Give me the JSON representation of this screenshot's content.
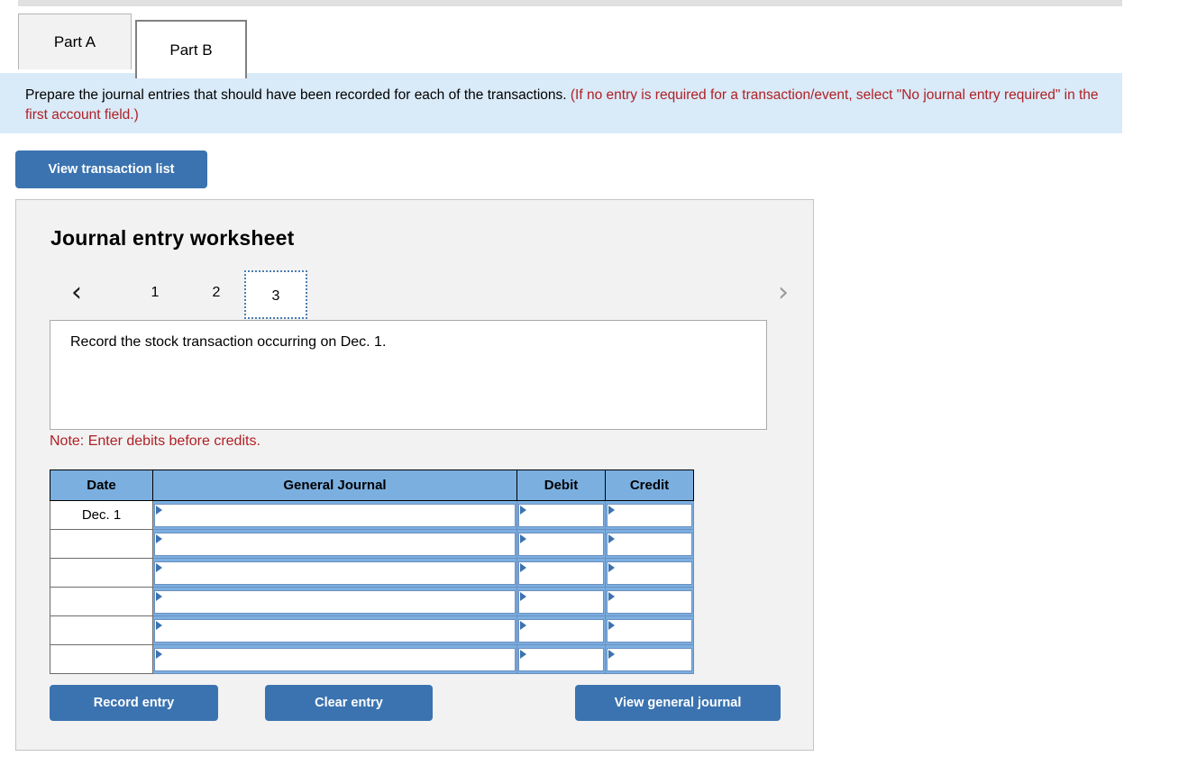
{
  "tabs": [
    {
      "label": "Part A",
      "active": false
    },
    {
      "label": "Part B",
      "active": true
    }
  ],
  "banner": {
    "text_black": "Prepare the journal entries that should have been recorded for each of the transactions.",
    "text_red": "(If no entry is required for a transaction/event, select \"No journal entry required\" in the first account field.)"
  },
  "toolbar": {
    "view_transaction_list_label": "View transaction list"
  },
  "worksheet": {
    "title": "Journal entry worksheet",
    "pager": {
      "prev_icon": "chevron-left-icon",
      "next_icon": "chevron-right-icon",
      "prev_glyph": "‹",
      "next_glyph": "›",
      "pages": [
        "1",
        "2",
        "3"
      ],
      "active_page": "3"
    },
    "description": "Record the stock transaction occurring on Dec. 1.",
    "note": "Note: Enter debits before credits.",
    "table": {
      "headers": [
        "Date",
        "General Journal",
        "Debit",
        "Credit"
      ],
      "rows": [
        {
          "date": "Dec. 1",
          "general_journal": "",
          "debit": "",
          "credit": ""
        },
        {
          "date": "",
          "general_journal": "",
          "debit": "",
          "credit": ""
        },
        {
          "date": "",
          "general_journal": "",
          "debit": "",
          "credit": ""
        },
        {
          "date": "",
          "general_journal": "",
          "debit": "",
          "credit": ""
        },
        {
          "date": "",
          "general_journal": "",
          "debit": "",
          "credit": ""
        },
        {
          "date": "",
          "general_journal": "",
          "debit": "",
          "credit": ""
        }
      ]
    },
    "actions": {
      "record_label": "Record entry",
      "clear_label": "Clear entry",
      "view_journal_label": "View general journal"
    }
  },
  "colors": {
    "accent_blue": "#3b73b0",
    "table_header_blue": "#7bafe0",
    "banner_blue": "#d9eaf8",
    "note_red": "#b01f24",
    "panel_grey": "#f2f2f2"
  }
}
